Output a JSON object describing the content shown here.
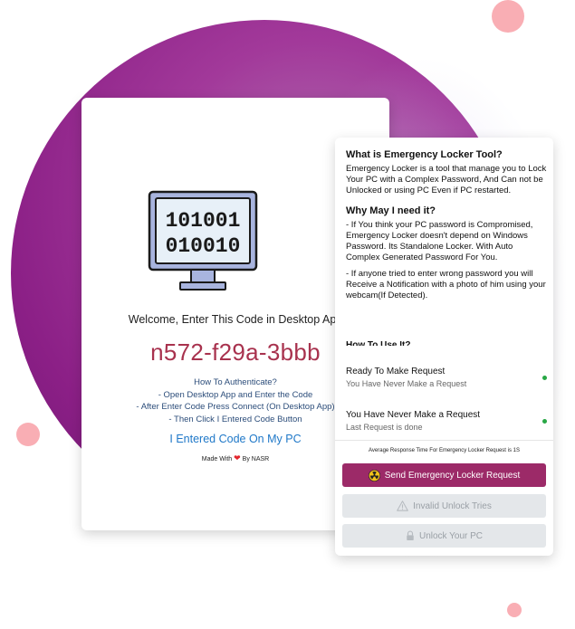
{
  "colors": {
    "accent": "#a8324e",
    "link": "#1f78c8",
    "button_primary": "#9c2a68",
    "status_ok": "#28a745"
  },
  "left_card": {
    "icon": "computer-binary-icon",
    "binary_lines": [
      "101001",
      "010010"
    ],
    "welcome": "Welcome, Enter This Code in Desktop App",
    "code": "n572-f29a-3bbb",
    "howto": {
      "title": "How To Authenticate?",
      "steps": [
        "- Open Desktop App and Enter the Code",
        "- After Enter Code Press Connect (On Desktop App)",
        "- Then Click I Entered Code Button"
      ]
    },
    "entered_label": "I Entered Code On My PC",
    "made_with_prefix": "Made With",
    "made_with_suffix": "By NASR"
  },
  "right_card": {
    "what_title": "What is Emergency Locker Tool?",
    "what_text": "Emergency Locker is a tool that manage you to Lock Your PC with a Complex Password, And Can not be Unlocked or using PC Even if PC restarted.",
    "why_title": "Why May I need it?",
    "why_p1": "- If You think your PC password is Compromised, Emergency Locker doesn't depend on Windows Password. Its Standalone Locker. With Auto Complex Generated Password For You.",
    "why_p2": "- If anyone tried to enter wrong password you will Receive a Notification with a photo of him using your webcam(If Detected).",
    "how_title_cut": "How To Use It?",
    "status1": {
      "title": "Ready To Make Request",
      "sub": "You Have Never Make a Request"
    },
    "status2": {
      "title": "You Have Never Make a Request",
      "sub": "Last Request is done"
    },
    "avg_text": "Average Response Time For Emergency Locker Request is 1S",
    "send_label": "Send Emergency Locker Request",
    "invalid_label": "Invalid Unlock Tries",
    "unlock_label": "Unlock Your PC"
  }
}
